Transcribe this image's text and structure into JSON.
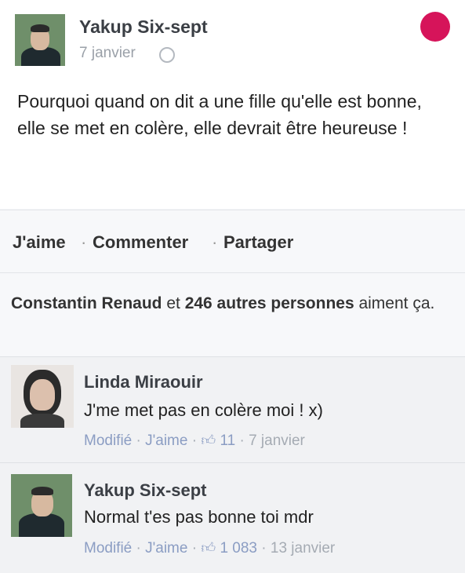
{
  "post": {
    "author": "Yakup Six-sept",
    "time": "7 janvier",
    "text": "Pourquoi quand on dit a une fille qu'elle est bonne, elle se met en colère, elle devrait être heureuse !"
  },
  "actions": {
    "like": "J'aime",
    "comment": "Commenter",
    "share": "Partager",
    "sep": "·"
  },
  "likes": {
    "first_name": "Constantin Renaud",
    "and": " et ",
    "count_text": "246 autres personnes",
    "suffix": " aiment ça."
  },
  "comments": [
    {
      "author": "Linda Miraouir",
      "text": "J'me met pas en colère moi ! x)",
      "modified": "Modifié",
      "like": "J'aime",
      "like_count": "11",
      "time": "7 janvier",
      "sep": " · "
    },
    {
      "author": "Yakup Six-sept",
      "text": "Normal t'es pas bonne toi mdr",
      "modified": "Modifié",
      "like": "J'aime",
      "like_count": "1 083",
      "time": "13 janvier",
      "sep": " · "
    }
  ],
  "colors": {
    "accent_dot": "#d6145a",
    "link": "#8b9dc3"
  },
  "icons": [
    "globe-icon",
    "thumbs-up-icon"
  ]
}
